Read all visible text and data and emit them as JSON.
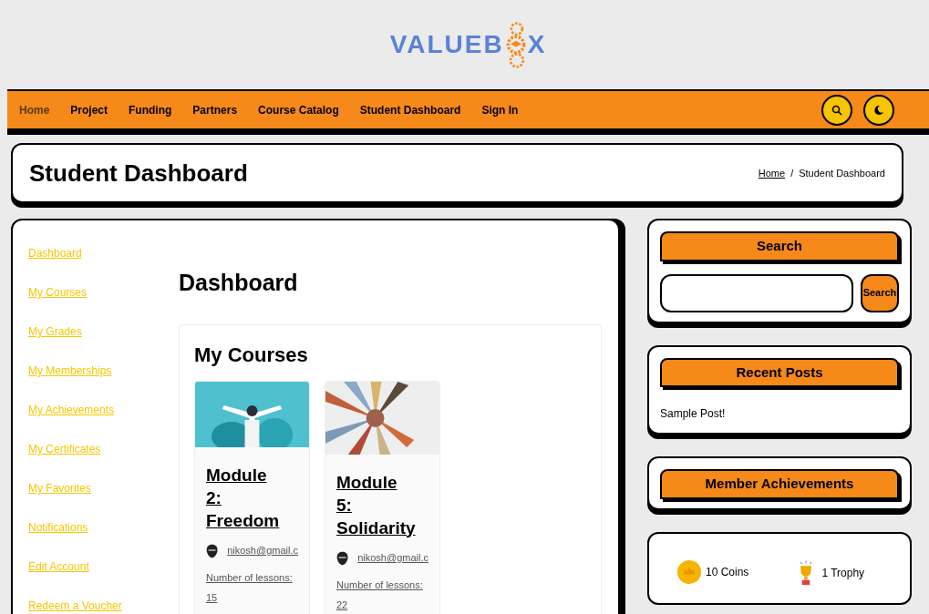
{
  "logo": {
    "text_before": "VALUEB",
    "text_after": "X"
  },
  "nav": [
    {
      "label": "Home",
      "selected": true
    },
    {
      "label": "Project",
      "selected": false
    },
    {
      "label": "Funding",
      "selected": false
    },
    {
      "label": "Partners",
      "selected": false
    },
    {
      "label": "Course Catalog",
      "selected": false
    },
    {
      "label": "Student Dashboard",
      "selected": false
    },
    {
      "label": "Sign In",
      "selected": false
    }
  ],
  "page_title": "Student Dashboard",
  "breadcrumb": [
    "Home",
    "/",
    "Student Dashboard"
  ],
  "sidebar_links": [
    "Dashboard",
    "My Courses",
    "My Grades",
    "My Memberships",
    "My Achievements",
    "My Certificates",
    "My Favorites",
    "Notifications",
    "Edit Account",
    "Redeem a Voucher"
  ],
  "main": {
    "heading": "Dashboard",
    "section": "My Courses"
  },
  "courses": [
    {
      "title": "Module 2: Freedom",
      "author": "nikosh@gmail.c",
      "lessons_label": "Number of lessons:",
      "lessons": "15"
    },
    {
      "title": "Module 5: Solidarity",
      "author": "nikosh@gmail.c",
      "lessons_label": "Number of lessons:",
      "lessons": "22"
    }
  ],
  "widgets": {
    "search": {
      "title": "Search",
      "button": "Search"
    },
    "recent": {
      "title": "Recent Posts",
      "posts": [
        "Sample Post!"
      ]
    },
    "achievements": {
      "title": "Member Achievements",
      "items": [
        {
          "kind": "coin",
          "label": "10 Coins"
        },
        {
          "kind": "trophy",
          "label": "1 Trophy"
        }
      ]
    }
  }
}
